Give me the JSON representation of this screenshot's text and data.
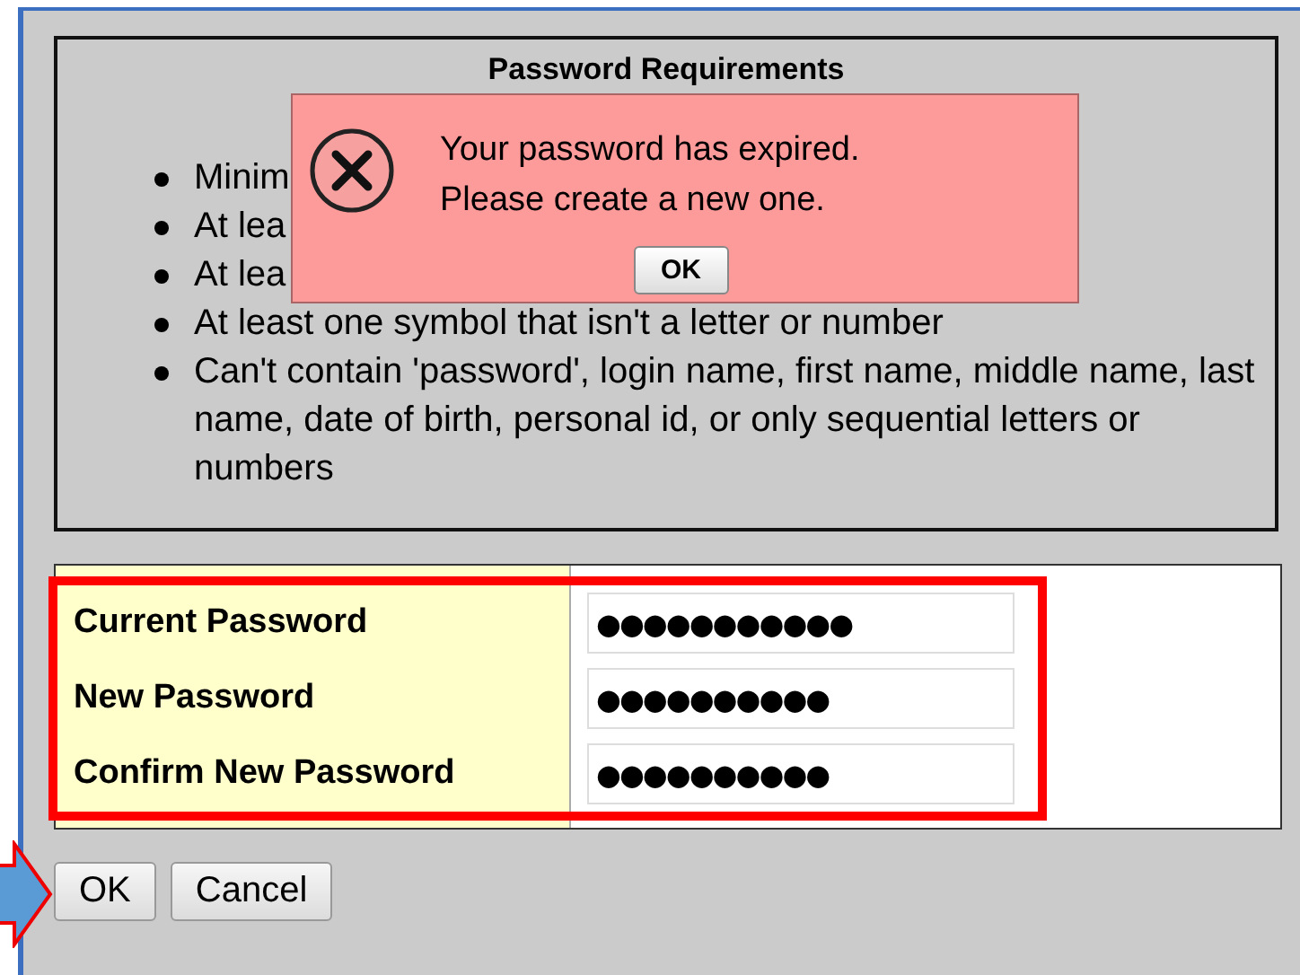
{
  "requirements": {
    "title": "Password Requirements",
    "items": [
      {
        "text": "Minim"
      },
      {
        "text": "At lea"
      },
      {
        "text": "At lea"
      },
      {
        "text": "At least one symbol that isn't a letter or number"
      },
      {
        "text": "Can't contain 'password', login name, first name, middle name, last name, date of birth, personal id, or only sequential letters or numbers"
      }
    ]
  },
  "alert": {
    "lines": [
      "Your password has expired.",
      "Please create a new one."
    ],
    "button": "OK"
  },
  "fields": [
    {
      "label": "Current Password",
      "value": "●●●●●●●●●●●"
    },
    {
      "label": "New Password",
      "value": "●●●●●●●●●●"
    },
    {
      "label": "Confirm New Password",
      "value": "●●●●●●●●●●"
    }
  ],
  "buttons": [
    "OK",
    "Cancel"
  ]
}
